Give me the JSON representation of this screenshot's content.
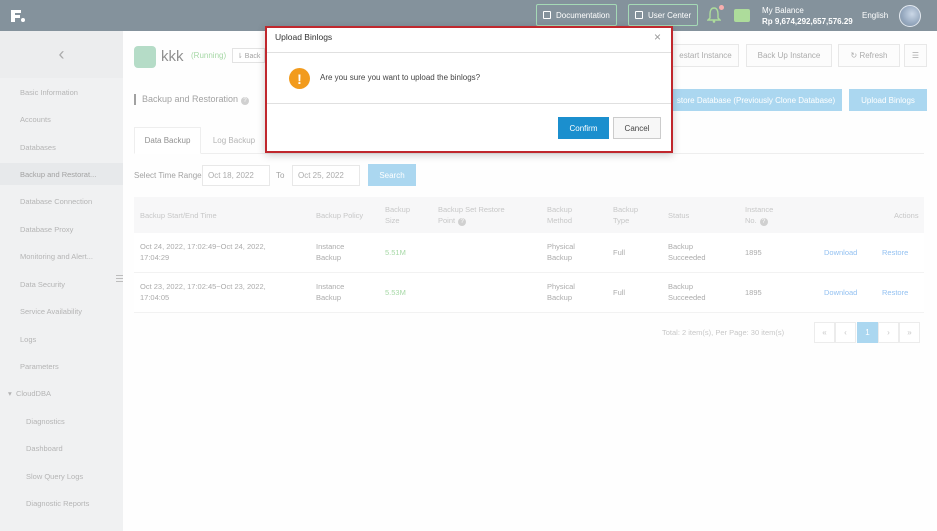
{
  "topbar": {
    "documentation": "Documentation",
    "user_center": "User Center",
    "balance_label": "My Balance",
    "balance_value": "Rp 9,674,292,657,576.29",
    "language": "English"
  },
  "sidebar": {
    "back": "‹",
    "items": [
      "Basic Information",
      "Accounts",
      "Databases",
      "Backup and Restorat...",
      "Database Connection",
      "Database Proxy",
      "Monitoring and Alert...",
      "Data Security",
      "Service Availability",
      "Logs",
      "Parameters",
      "CloudDBA",
      "Diagnostics",
      "Dashboard",
      "Slow Query Logs",
      "Diagnostic Reports"
    ]
  },
  "instance": {
    "name": "kkk",
    "status": "(Running)",
    "back_label": "⇂ Back"
  },
  "header_buttons": {
    "restart": "estart Instance",
    "backup": "Back Up Instance",
    "refresh": "Refresh"
  },
  "section": {
    "title": "Backup and Restoration",
    "restore_db": "store Database (Previously Clone Database)",
    "upload_binlogs": "Upload Binlogs"
  },
  "tabs": [
    "Data Backup",
    "Log Backup"
  ],
  "filter": {
    "label": "Select Time Range",
    "from": "Oct 18, 2022",
    "to_label": "To",
    "to": "Oct 25, 2022",
    "search": "Search"
  },
  "table": {
    "headers": [
      "Backup Start/End Time",
      "Backup Policy",
      "Backup Size",
      "Backup Set Restore Point",
      "Backup Method",
      "Backup Type",
      "Status",
      "Instance No.",
      "Actions"
    ],
    "rows": [
      {
        "time": "Oct 24, 2022, 17:02:49~Oct 24, 2022, 17:04:29",
        "policy": "Instance Backup",
        "size": "5.51M",
        "method": "Physical Backup",
        "type": "Full",
        "status": "Backup Succeeded",
        "instance_no": "1895",
        "download": "Download",
        "restore": "Restore"
      },
      {
        "time": "Oct 23, 2022, 17:02:45~Oct 23, 2022, 17:04:05",
        "policy": "Instance Backup",
        "size": "5.53M",
        "method": "Physical Backup",
        "type": "Full",
        "status": "Backup Succeeded",
        "instance_no": "1895",
        "download": "Download",
        "restore": "Restore"
      }
    ]
  },
  "pagination": {
    "info": "Total: 2 item(s),   Per Page: 30 item(s)",
    "first": "«",
    "prev": "‹",
    "current": "1",
    "next": "›",
    "last": "»"
  },
  "dialog": {
    "title": "Upload Binlogs",
    "message": "Are you sure you want to upload the binlogs?",
    "confirm": "Confirm",
    "cancel": "Cancel",
    "close": "×"
  },
  "colors": {
    "topbar": "#1f3a4c",
    "accent": "#67b7e3",
    "confirm": "#1b8fce",
    "warning": "#f29b1d",
    "success": "#5cb85c"
  }
}
